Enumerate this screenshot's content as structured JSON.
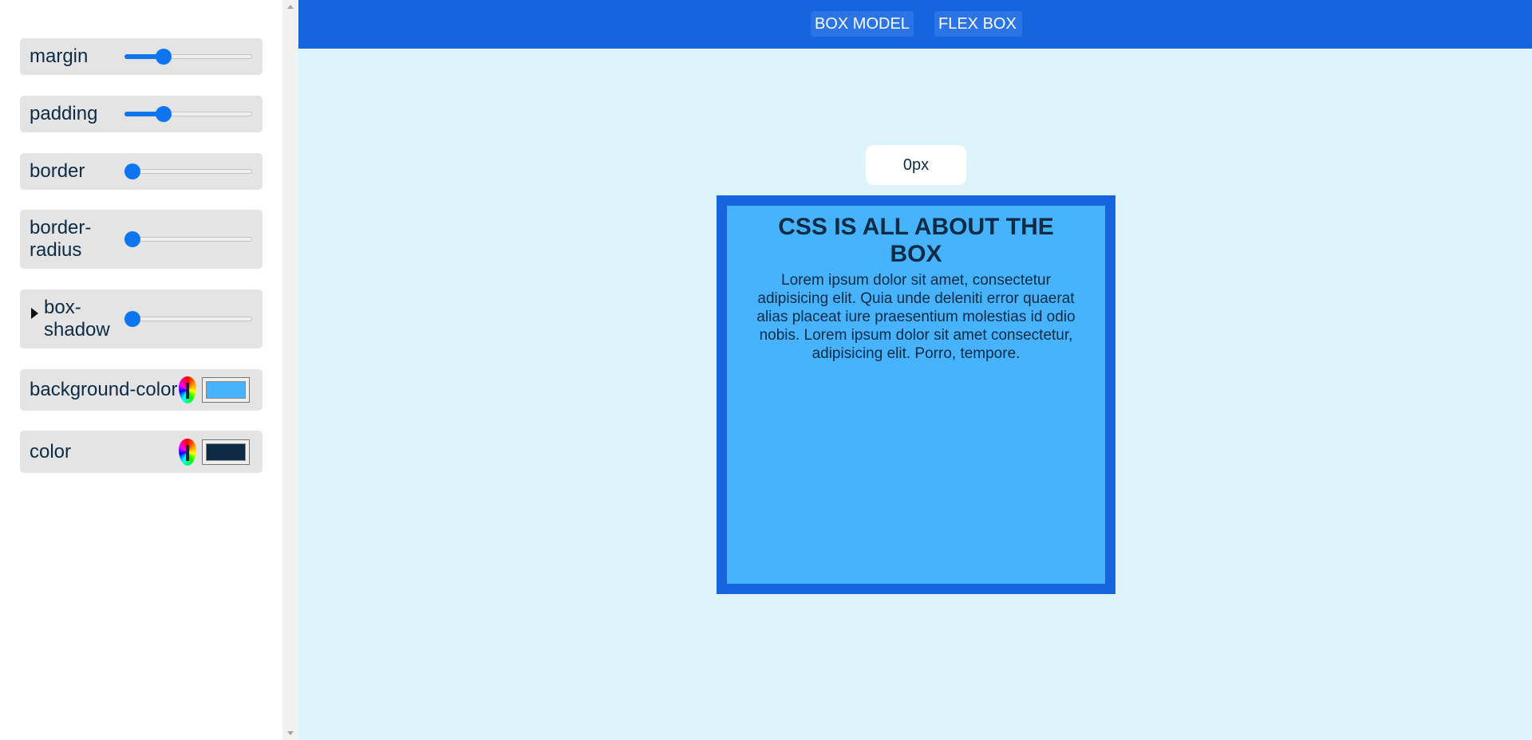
{
  "sidebar": {
    "margin": {
      "label": "margin",
      "value": 0.28
    },
    "padding": {
      "label": "padding",
      "value": 0.28
    },
    "border": {
      "label": "border",
      "value": 0
    },
    "border_radius": {
      "label": "border-radius",
      "label_line1": "border-",
      "label_line2": "radius",
      "value": 0
    },
    "box_shadow": {
      "label": "box-shadow",
      "label_line1": "box-",
      "label_line2": "shadow",
      "value": 0
    },
    "background_color": {
      "label": "background-color",
      "value": "#46b3fc"
    },
    "color": {
      "label": "color",
      "value": "#0d2b44"
    }
  },
  "header": {
    "nav": [
      "BOX MODEL",
      "FLEX BOX"
    ],
    "color": "#1765de"
  },
  "main": {
    "readout": "0px",
    "box": {
      "title": "CSS IS ALL ABOUT THE BOX",
      "body": "Lorem ipsum dolor sit amet, consectetur adipisicing elit. Quia unde deleniti error quaerat alias placeat iure praesentium molestias id odio nobis. Lorem ipsum dolor sit amet consectetur, adipisicing elit. Porro, tempore.",
      "border_color": "#1765de",
      "background": "#46b3fc",
      "text_color": "#0d2b44"
    },
    "background": "#ddf4fc"
  }
}
